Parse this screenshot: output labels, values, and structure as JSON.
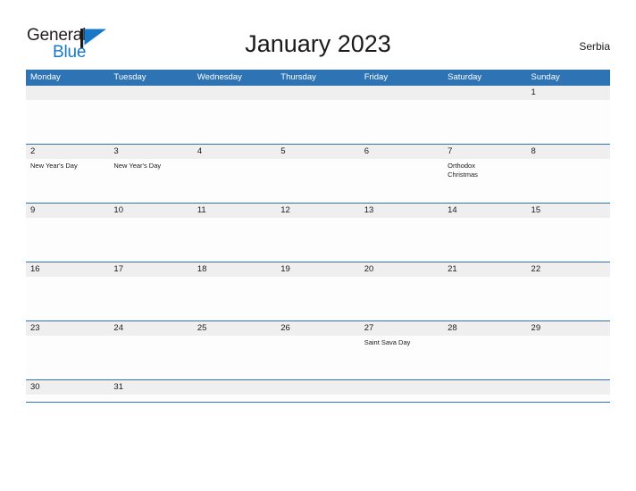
{
  "brand": {
    "name_part1": "General",
    "name_part2": "Blue",
    "flag_icon": "blue-triangle-flag-icon",
    "color_dark": "#231f20",
    "color_blue": "#1878c8"
  },
  "header": {
    "title": "January 2023",
    "region": "Serbia"
  },
  "theme": {
    "header_blue": "#2e74b5",
    "band_gray": "#efefef",
    "text_dark": "#1a1a1a",
    "cell_white": "#fdfdfd"
  },
  "calendar": {
    "weekdays": [
      "Monday",
      "Tuesday",
      "Wednesday",
      "Thursday",
      "Friday",
      "Saturday",
      "Sunday"
    ],
    "weeks": [
      {
        "days": [
          {
            "num": "",
            "events": []
          },
          {
            "num": "",
            "events": []
          },
          {
            "num": "",
            "events": []
          },
          {
            "num": "",
            "events": []
          },
          {
            "num": "",
            "events": []
          },
          {
            "num": "",
            "events": []
          },
          {
            "num": "1",
            "events": []
          }
        ]
      },
      {
        "days": [
          {
            "num": "2",
            "events": [
              "New Year's Day"
            ]
          },
          {
            "num": "3",
            "events": [
              "New Year's Day"
            ]
          },
          {
            "num": "4",
            "events": []
          },
          {
            "num": "5",
            "events": []
          },
          {
            "num": "6",
            "events": []
          },
          {
            "num": "7",
            "events": [
              "Orthodox Christmas"
            ]
          },
          {
            "num": "8",
            "events": []
          }
        ]
      },
      {
        "days": [
          {
            "num": "9",
            "events": []
          },
          {
            "num": "10",
            "events": []
          },
          {
            "num": "11",
            "events": []
          },
          {
            "num": "12",
            "events": []
          },
          {
            "num": "13",
            "events": []
          },
          {
            "num": "14",
            "events": []
          },
          {
            "num": "15",
            "events": []
          }
        ]
      },
      {
        "days": [
          {
            "num": "16",
            "events": []
          },
          {
            "num": "17",
            "events": []
          },
          {
            "num": "18",
            "events": []
          },
          {
            "num": "19",
            "events": []
          },
          {
            "num": "20",
            "events": []
          },
          {
            "num": "21",
            "events": []
          },
          {
            "num": "22",
            "events": []
          }
        ]
      },
      {
        "days": [
          {
            "num": "23",
            "events": []
          },
          {
            "num": "24",
            "events": []
          },
          {
            "num": "25",
            "events": []
          },
          {
            "num": "26",
            "events": []
          },
          {
            "num": "27",
            "events": [
              "Saint Sava Day"
            ]
          },
          {
            "num": "28",
            "events": []
          },
          {
            "num": "29",
            "events": []
          }
        ]
      },
      {
        "days": [
          {
            "num": "30",
            "events": []
          },
          {
            "num": "31",
            "events": []
          },
          {
            "num": "",
            "events": []
          },
          {
            "num": "",
            "events": []
          },
          {
            "num": "",
            "events": []
          },
          {
            "num": "",
            "events": []
          },
          {
            "num": "",
            "events": []
          }
        ]
      }
    ]
  }
}
